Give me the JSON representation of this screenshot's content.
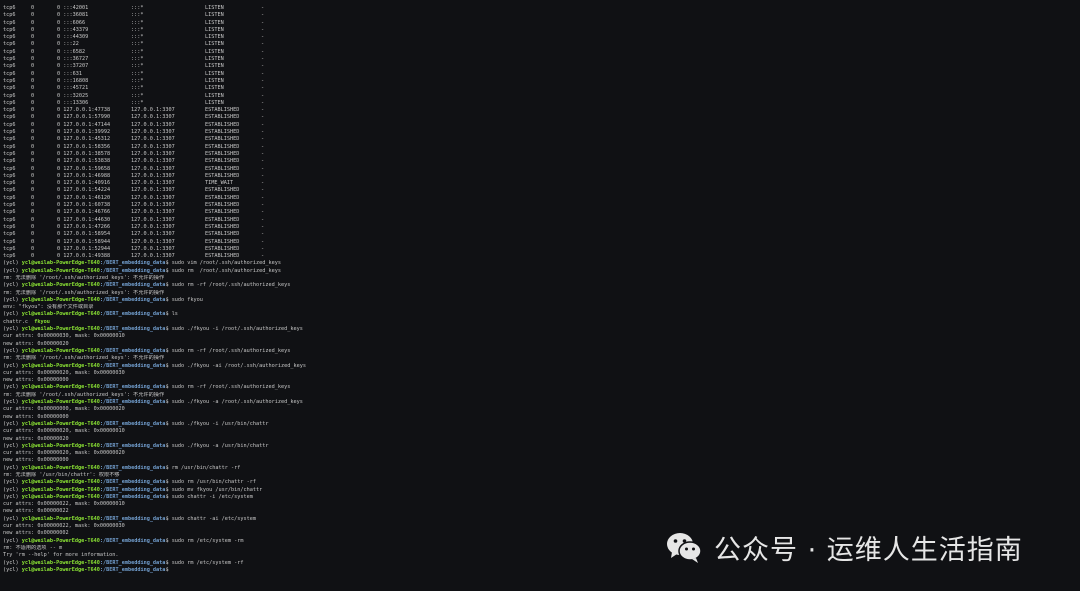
{
  "netstat": [
    [
      "tcp6",
      "0",
      "0 :::42001",
      ":::*",
      "LISTEN",
      "-"
    ],
    [
      "tcp6",
      "0",
      "0 :::36081",
      ":::*",
      "LISTEN",
      "-"
    ],
    [
      "tcp6",
      "0",
      "0 :::6066",
      ":::*",
      "LISTEN",
      "-"
    ],
    [
      "tcp6",
      "0",
      "0 :::43379",
      ":::*",
      "LISTEN",
      "-"
    ],
    [
      "tcp6",
      "0",
      "0 :::44309",
      ":::*",
      "LISTEN",
      "-"
    ],
    [
      "tcp6",
      "0",
      "0 :::22",
      ":::*",
      "LISTEN",
      "-"
    ],
    [
      "tcp6",
      "0",
      "0 :::6582",
      ":::*",
      "LISTEN",
      "-"
    ],
    [
      "tcp6",
      "0",
      "0 :::36727",
      ":::*",
      "LISTEN",
      "-"
    ],
    [
      "tcp6",
      "0",
      "0 :::37207",
      ":::*",
      "LISTEN",
      "-"
    ],
    [
      "tcp6",
      "0",
      "0 :::631",
      ":::*",
      "LISTEN",
      "-"
    ],
    [
      "tcp6",
      "0",
      "0 :::16808",
      ":::*",
      "LISTEN",
      "-"
    ],
    [
      "tcp6",
      "0",
      "0 :::45721",
      ":::*",
      "LISTEN",
      "-"
    ],
    [
      "tcp6",
      "0",
      "0 :::32025",
      ":::*",
      "LISTEN",
      "-"
    ],
    [
      "tcp6",
      "0",
      "0 :::13306",
      ":::*",
      "LISTEN",
      "-"
    ],
    [
      "tcp6",
      "0",
      "0 127.0.0.1:47738",
      "127.0.0.1:3307",
      "ESTABLISHED",
      "-"
    ],
    [
      "tcp6",
      "0",
      "0 127.0.0.1:57990",
      "127.0.0.1:3307",
      "ESTABLISHED",
      "-"
    ],
    [
      "tcp6",
      "0",
      "0 127.0.0.1:47144",
      "127.0.0.1:3307",
      "ESTABLISHED",
      "-"
    ],
    [
      "tcp6",
      "0",
      "0 127.0.0.1:39992",
      "127.0.0.1:3307",
      "ESTABLISHED",
      "-"
    ],
    [
      "tcp6",
      "0",
      "0 127.0.0.1:45312",
      "127.0.0.1:3307",
      "ESTABLISHED",
      "-"
    ],
    [
      "tcp6",
      "0",
      "0 127.0.0.1:58356",
      "127.0.0.1:3307",
      "ESTABLISHED",
      "-"
    ],
    [
      "tcp6",
      "0",
      "0 127.0.0.1:38578",
      "127.0.0.1:3307",
      "ESTABLISHED",
      "-"
    ],
    [
      "tcp6",
      "0",
      "0 127.0.0.1:53838",
      "127.0.0.1:3307",
      "ESTABLISHED",
      "-"
    ],
    [
      "tcp6",
      "0",
      "0 127.0.0.1:59658",
      "127.0.0.1:3307",
      "ESTABLISHED",
      "-"
    ],
    [
      "tcp6",
      "0",
      "0 127.0.0.1:46988",
      "127.0.0.1:3307",
      "ESTABLISHED",
      "-"
    ],
    [
      "tcp6",
      "0",
      "0 127.0.0.1:40916",
      "127.0.0.1:3307",
      "TIME_WAIT",
      "-"
    ],
    [
      "tcp6",
      "0",
      "0 127.0.0.1:54224",
      "127.0.0.1:3307",
      "ESTABLISHED",
      "-"
    ],
    [
      "tcp6",
      "0",
      "0 127.0.0.1:46120",
      "127.0.0.1:3307",
      "ESTABLISHED",
      "-"
    ],
    [
      "tcp6",
      "0",
      "0 127.0.0.1:60738",
      "127.0.0.1:3307",
      "ESTABLISHED",
      "-"
    ],
    [
      "tcp6",
      "0",
      "0 127.0.0.1:46766",
      "127.0.0.1:3307",
      "ESTABLISHED",
      "-"
    ],
    [
      "tcp6",
      "0",
      "0 127.0.0.1:44630",
      "127.0.0.1:3307",
      "ESTABLISHED",
      "-"
    ],
    [
      "tcp6",
      "0",
      "0 127.0.0.1:47266",
      "127.0.0.1:3307",
      "ESTABLISHED",
      "-"
    ],
    [
      "tcp6",
      "0",
      "0 127.0.0.1:58954",
      "127.0.0.1:3307",
      "ESTABLISHED",
      "-"
    ],
    [
      "tcp6",
      "0",
      "0 127.0.0.1:58944",
      "127.0.0.1:3307",
      "ESTABLISHED",
      "-"
    ],
    [
      "tcp6",
      "0",
      "0 127.0.0.1:52944",
      "127.0.0.1:3307",
      "ESTABLISHED",
      "-"
    ],
    [
      "tcp6",
      "0",
      "0 127.0.0.1:49388",
      "127.0.0.1:3307",
      "ESTABLISHED",
      "-"
    ]
  ],
  "prompt": {
    "env": "(ycl) ",
    "user": "ycl@weilab-PowerEdge-T640",
    "path": ":/BERT_embedding_data",
    "suffix": "$ "
  },
  "session": [
    {
      "type": "cmd",
      "text": "sudo vim /root/.ssh/authorized_keys"
    },
    {
      "type": "cmd",
      "text": "sudo rm  /root/.ssh/authorized_keys"
    },
    {
      "type": "out",
      "text": "rm: 无法删除 '/root/.ssh/authorized_keys': 不允许的操作"
    },
    {
      "type": "cmd",
      "text": "sudo rm -rf /root/.ssh/authorized_keys"
    },
    {
      "type": "out",
      "text": "rm: 无法删除 '/root/.ssh/authorized_keys': 不允许的操作"
    },
    {
      "type": "cmd",
      "text": "sudo fkyou"
    },
    {
      "type": "out",
      "text": "env: \"fkyou\": 没有那个文件或目录"
    },
    {
      "type": "cmd",
      "text": "ls"
    },
    {
      "type": "ls",
      "text": "chattr.c",
      "exe": "fkyou"
    },
    {
      "type": "cmd",
      "text": "sudo ./fkyou -i /root/.ssh/authorized_keys"
    },
    {
      "type": "out",
      "text": "cur attrs: 0x00000030, mask: 0x00000010"
    },
    {
      "type": "out",
      "text": "new attrs: 0x00000020"
    },
    {
      "type": "cmd",
      "text": "sudo rm -rf /root/.ssh/authorized_keys"
    },
    {
      "type": "out",
      "text": "rm: 无法删除 '/root/.ssh/authorized_keys': 不允许的操作"
    },
    {
      "type": "cmd",
      "text": "sudo ./fkyou -ai /root/.ssh/authorized_keys"
    },
    {
      "type": "out",
      "text": "cur attrs: 0x00000020, mask: 0x00000030"
    },
    {
      "type": "out",
      "text": "new attrs: 0x00000000"
    },
    {
      "type": "cmd",
      "text": "sudo rm -rf /root/.ssh/authorized_keys"
    },
    {
      "type": "out",
      "text": "rm: 无法删除 '/root/.ssh/authorized_keys': 不允许的操作"
    },
    {
      "type": "cmd",
      "text": "sudo ./fkyou -a /root/.ssh/authorized_keys"
    },
    {
      "type": "out",
      "text": "cur attrs: 0x00000000, mask: 0x00000020"
    },
    {
      "type": "out",
      "text": "new attrs: 0x00000000"
    },
    {
      "type": "cmd",
      "text": "sudo ./fkyou -i /usr/bin/chattr"
    },
    {
      "type": "out",
      "text": "cur attrs: 0x00000020, mask: 0x00000010"
    },
    {
      "type": "out",
      "text": "new attrs: 0x00000020"
    },
    {
      "type": "cmd",
      "text": "sudo ./fkyou -a /usr/bin/chattr"
    },
    {
      "type": "out",
      "text": "cur attrs: 0x00000020, mask: 0x00000020"
    },
    {
      "type": "out",
      "text": "new attrs: 0x00000000"
    },
    {
      "type": "cmd",
      "text": "rm /usr/bin/chattr -rf"
    },
    {
      "type": "out",
      "text": "rm: 无法删除 '/usr/bin/chattr': 权限不够"
    },
    {
      "type": "cmd",
      "text": "sudo rm /usr/bin/chattr -rf"
    },
    {
      "type": "cmd",
      "text": "sudo mv fkyou /usr/bin/chattr"
    },
    {
      "type": "cmd",
      "text": "sudo chattr -i /etc/system"
    },
    {
      "type": "out",
      "text": "cur attrs: 0x00000022, mask: 0x00000010"
    },
    {
      "type": "out",
      "text": "new attrs: 0x00000022"
    },
    {
      "type": "cmd",
      "text": "sudo chattr -ai /etc/system"
    },
    {
      "type": "out",
      "text": "cur attrs: 0x00000022, mask: 0x00000030"
    },
    {
      "type": "out",
      "text": "new attrs: 0x00000002"
    },
    {
      "type": "cmd",
      "text": "sudo rm /etc/system -rm"
    },
    {
      "type": "out",
      "text": "rm: 不适用的选项 -- m"
    },
    {
      "type": "out",
      "text": "Try 'rm --help' for more information."
    },
    {
      "type": "cmd",
      "text": "sudo rm /etc/system -rf"
    },
    {
      "type": "cmd",
      "text": ""
    }
  ],
  "watermark": {
    "text": "公众号 · 运维人生活指南",
    "icon": "wechat-icon",
    "color": "#e6e6e6"
  },
  "colors": {
    "background": "#101114",
    "user": "#8ae234",
    "path": "#729fcf",
    "text": "#c7c7c7"
  }
}
